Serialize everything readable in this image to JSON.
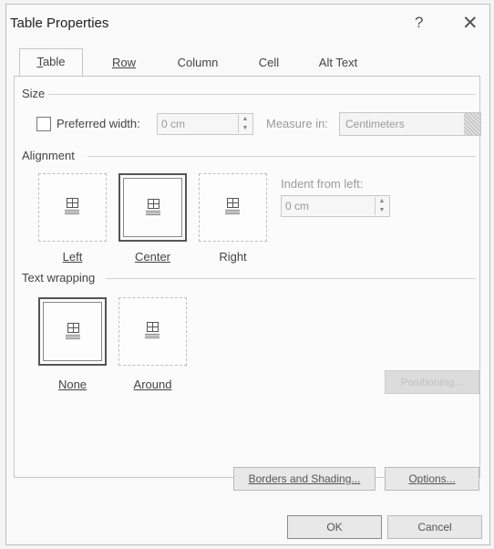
{
  "window": {
    "title": "Table Properties",
    "help": "?",
    "close": "✕"
  },
  "tabs": [
    {
      "label": "Table",
      "active": true
    },
    {
      "label": "Row",
      "active": false
    },
    {
      "label": "Column",
      "active": false
    },
    {
      "label": "Cell",
      "active": false
    },
    {
      "label": "Alt Text",
      "active": false
    }
  ],
  "size": {
    "section": "Size",
    "preferred_width_label": "Preferred width:",
    "preferred_width_checked": false,
    "preferred_width_value": "0 cm",
    "measure_in_label": "Measure in:",
    "measure_in_value": "Centimeters"
  },
  "alignment": {
    "section": "Alignment",
    "options": [
      {
        "label": "Left",
        "selected": false
      },
      {
        "label": "Center",
        "selected": true
      },
      {
        "label": "Right",
        "selected": false
      }
    ],
    "indent_label": "Indent from left:",
    "indent_value": "0 cm"
  },
  "wrapping": {
    "section": "Text wrapping",
    "options": [
      {
        "label": "None",
        "selected": true
      },
      {
        "label": "Around",
        "selected": false
      }
    ],
    "positioning_button": "Positioning..."
  },
  "buttons": {
    "borders": "Borders and Shading...",
    "options": "Options...",
    "ok": "OK",
    "cancel": "Cancel"
  }
}
